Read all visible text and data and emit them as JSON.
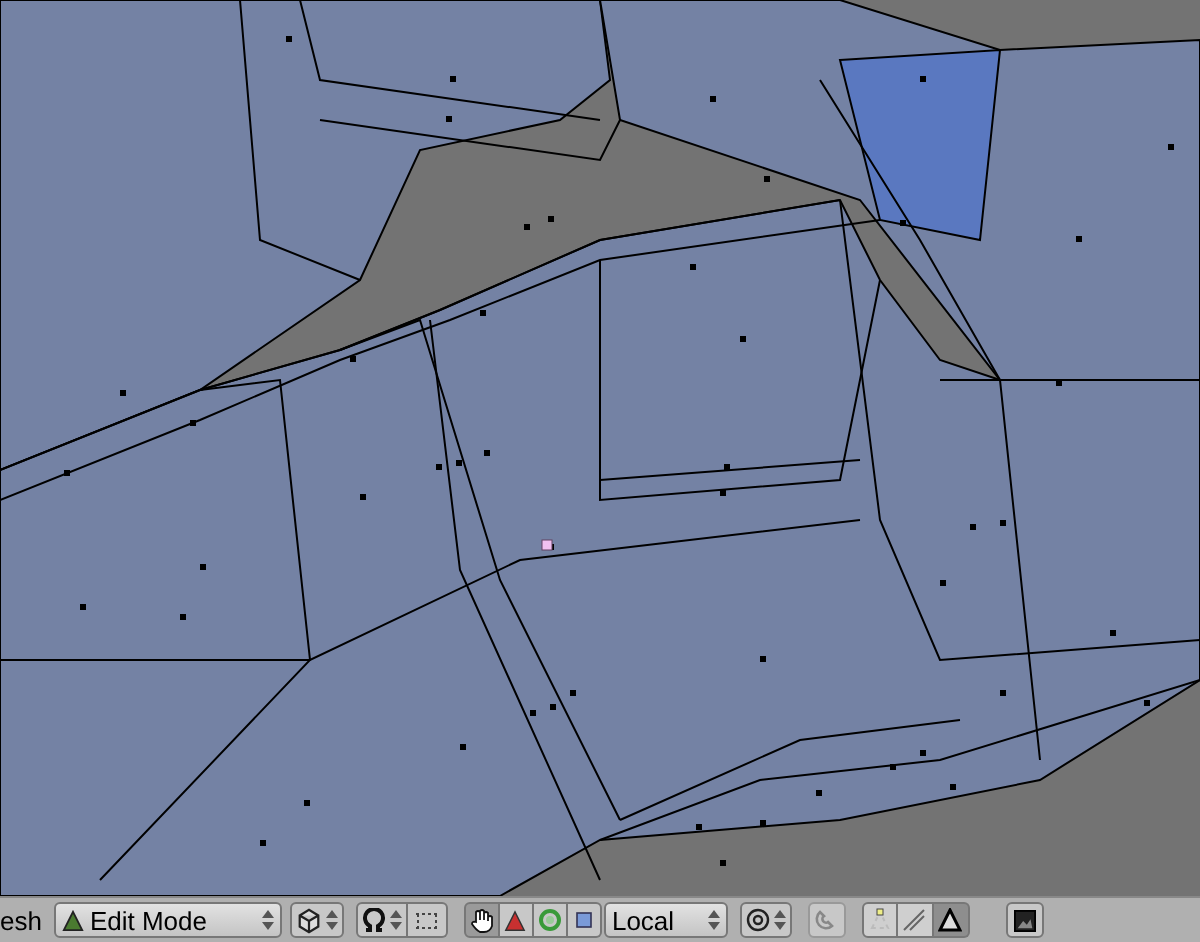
{
  "header": {
    "menu_label": "esh",
    "mode": "Edit Mode",
    "manipulator_on": true,
    "orientation": "Local"
  },
  "select_modes": [
    {
      "kind": "vertex",
      "selected": false
    },
    {
      "kind": "edge",
      "selected": false
    },
    {
      "kind": "face",
      "selected": true
    }
  ]
}
